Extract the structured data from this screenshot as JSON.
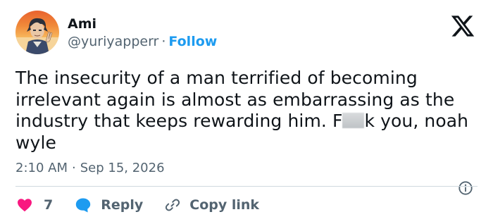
{
  "author": {
    "name": "Ami",
    "handle": "@yuriyapperr",
    "separator": "·",
    "follow_label": "Follow"
  },
  "tweet": {
    "text_before_censor": "The insecurity of a man terrified of becoming irrelevant again is almost as embarrassing as the industry that keeps rewarding him. F",
    "text_after_censor": "k you, noah wyle",
    "time": "2:10 AM",
    "separator": "·",
    "date": "Sep 15, 2026"
  },
  "actions": {
    "like_count": "7",
    "reply_label": "Reply",
    "copy_link_label": "Copy link"
  },
  "icons": {
    "platform": "x-logo-icon",
    "info": "info-icon",
    "like": "heart-icon",
    "reply": "reply-bubble-icon",
    "copy": "link-icon"
  },
  "colors": {
    "text": "#0f1419",
    "secondary": "#536471",
    "accent": "#1d9bf0",
    "like": "#f91880",
    "divider": "#cfd9de"
  }
}
